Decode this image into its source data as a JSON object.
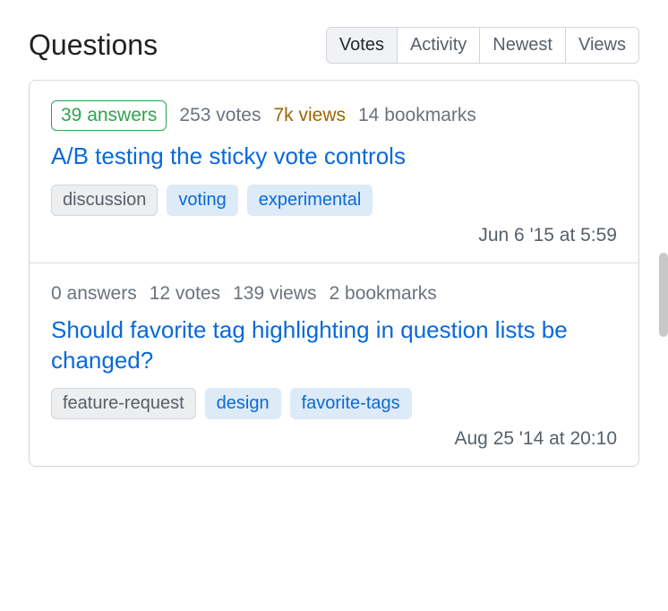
{
  "header": {
    "title": "Questions"
  },
  "sort_tabs": [
    {
      "label": "Votes",
      "active": true
    },
    {
      "label": "Activity",
      "active": false
    },
    {
      "label": "Newest",
      "active": false
    },
    {
      "label": "Views",
      "active": false
    }
  ],
  "questions": [
    {
      "answers": {
        "count": 39,
        "label": "39 answers",
        "has_answers": true
      },
      "votes": "253 votes",
      "views": {
        "text": "7k views",
        "hot": true
      },
      "bookmarks": "14 bookmarks",
      "title": "A/B testing the sticky vote controls",
      "tags": [
        {
          "name": "discussion",
          "required": true
        },
        {
          "name": "voting",
          "required": false
        },
        {
          "name": "experimental",
          "required": false
        }
      ],
      "timestamp": "Jun 6 '15 at 5:59"
    },
    {
      "answers": {
        "count": 0,
        "label": "0 answers",
        "has_answers": false
      },
      "votes": "12 votes",
      "views": {
        "text": "139 views",
        "hot": false
      },
      "bookmarks": "2 bookmarks",
      "title": "Should favorite tag highlighting in question lists be changed?",
      "tags": [
        {
          "name": "feature-request",
          "required": true
        },
        {
          "name": "design",
          "required": false
        },
        {
          "name": "favorite-tags",
          "required": false
        }
      ],
      "timestamp": "Aug 25 '14 at 20:10"
    }
  ]
}
